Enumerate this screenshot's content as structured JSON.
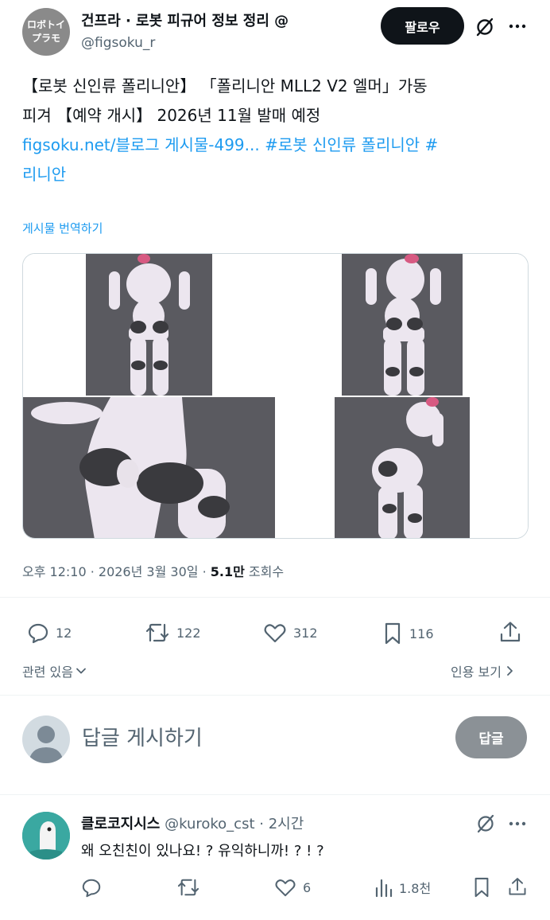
{
  "author": {
    "avatar_text_line1": "ロボトイ",
    "avatar_text_line2": "プラモ",
    "display_name": "건프라 · 로봇 피규어 정보 정리 @",
    "handle": "@figsoku_r"
  },
  "header": {
    "follow_label": "팔로우",
    "grok_icon": "slash-circle-icon",
    "more_icon": "more-dots-icon"
  },
  "tweet": {
    "line1": "【로봇 신인류 폴리니안】 「폴리니안 MLL2 V2 엘머」가동",
    "line2": "피겨 【예약 개시】 2026년 11월 발매 예정",
    "line3_link": "figsoku.net/블로그 게시물-499... #로봇 신인류 폴리니안 #",
    "line4_link": "리니안",
    "translate_label": "게시물 번역하기"
  },
  "media": {
    "image_count": 4,
    "images": [
      "figure-front-view",
      "figure-front-view-alt",
      "figure-hip-closeup",
      "figure-pose-side"
    ]
  },
  "meta": {
    "time_date": "오후 12:10 · 2026년 3월 30일 · ",
    "views_count": "5.1만",
    "views_label": " 조회수"
  },
  "actions": {
    "replies": "12",
    "reposts": "122",
    "likes": "312",
    "bookmarks": "116"
  },
  "related": {
    "label": "관련 있음",
    "quotes_label": "인용 보기"
  },
  "composer": {
    "placeholder": "답글 게시하기",
    "button_label": "답글"
  },
  "reply": {
    "name": "클로코지시스",
    "handle": "@kuroko_cst",
    "time": " · 2시간",
    "text": "왜 오친친이 있나요! ? 유익하니까! ? ! ?",
    "likes": "6",
    "views": "1.8천"
  },
  "colors": {
    "accent": "#1d9bf0",
    "text": "#0f1419",
    "muted": "#536471",
    "border": "#cfd9de",
    "button_dark": "#0f1419",
    "button_disabled": "#8b9196"
  }
}
